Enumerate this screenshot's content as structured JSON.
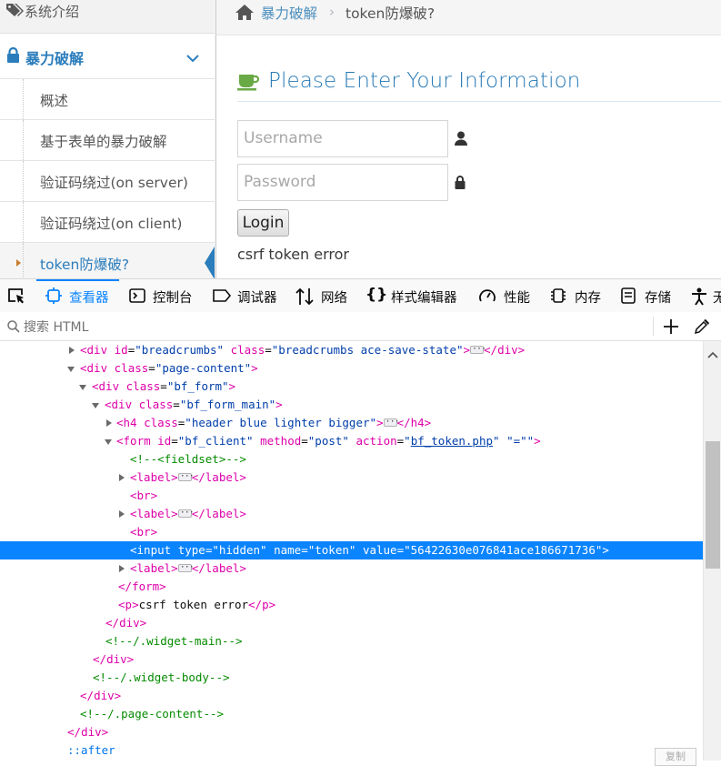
{
  "sidebar": {
    "top_item": "系统介绍",
    "category": "暴力破解",
    "items": [
      "概述",
      "基于表单的暴力破解",
      "验证码绕过(on server)",
      "验证码绕过(on client)",
      "token防爆破?"
    ]
  },
  "breadcrumb": {
    "home_label": "暴力破解",
    "current": "token防爆破?"
  },
  "form": {
    "heading": "Please Enter Your Information",
    "username_placeholder": "Username",
    "password_placeholder": "Password",
    "login_label": "Login",
    "error_text": "csrf token error"
  },
  "devtools": {
    "tabs": [
      "查看器",
      "控制台",
      "调试器",
      "网络",
      "样式编辑器",
      "性能",
      "内存",
      "存储",
      "无"
    ],
    "selected_tab": "查看器",
    "search_placeholder": "搜索 HTML",
    "copy_label": "复制",
    "tree": {
      "l0": {
        "a": "div",
        "b": "id",
        "c": "\"breadcrumbs\"",
        "d": "class",
        "e": "\"breadcrumbs ace-save-state\"",
        "f": "div"
      },
      "l1": {
        "a": "div",
        "b": "class",
        "c": "\"page-content\""
      },
      "l2": {
        "a": "div",
        "b": "class",
        "c": "\"bf_form\""
      },
      "l3": {
        "a": "div",
        "b": "class",
        "c": "\"bf_form_main\""
      },
      "l4": {
        "a": "h4",
        "b": "class",
        "c": "\"header blue lighter bigger\"",
        "d": "h4"
      },
      "l5": {
        "a": "form",
        "b": "id",
        "c": "\"bf_client\"",
        "d": "method",
        "e": "\"post\"",
        "f": "action",
        "g": "bf_token.php",
        "h": "\"=\"\""
      },
      "l6": "<!--<fieldset>-->",
      "l7": {
        "a": "label",
        "b": "label"
      },
      "l8": "br",
      "l9": {
        "a": "label",
        "b": "label"
      },
      "l10": "br",
      "l11": {
        "a": "input",
        "b": "type",
        "c": "\"hidden\"",
        "d": "name",
        "e": "\"token\"",
        "f": "value",
        "g": "\"56422630e076841ace186671736\""
      },
      "l12": {
        "a": "label",
        "b": "label"
      },
      "l13": "form",
      "l14": {
        "a": "p",
        "b": "csrf token error",
        "c": "p"
      },
      "l15": "div",
      "l16": "<!--/.widget-main-->",
      "l17": "div",
      "l18": "<!--/.widget-body-->",
      "l19": "div",
      "l20": "<!--/.page-content-->",
      "l21": "div",
      "l22": "::after"
    }
  },
  "colors": {
    "accent": "#0a84ff",
    "brand_blue": "#2b7dbc",
    "tag": "#dd00a9",
    "attr_value": "#003eaa",
    "comment": "#058b00"
  }
}
